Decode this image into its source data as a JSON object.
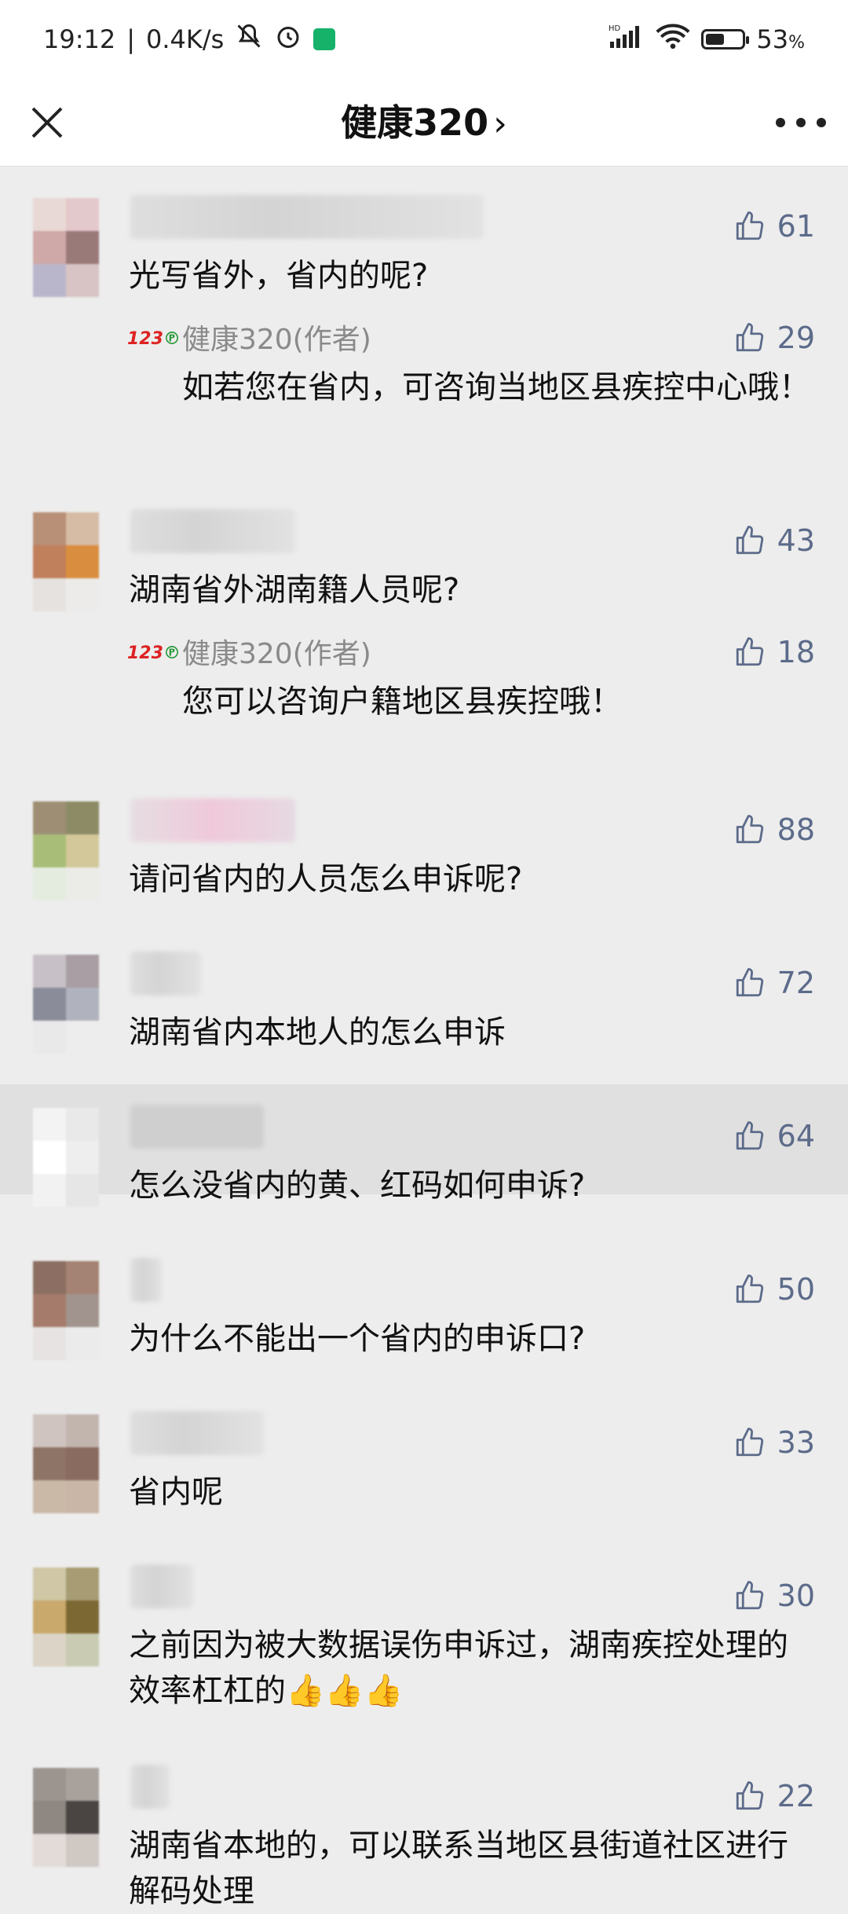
{
  "status_bar": {
    "time": "19:12",
    "speed": "0.4K/s",
    "battery": "53",
    "battery_unit": "%",
    "battery_level": 0.53,
    "icons": [
      "mute-icon",
      "alarm-icon",
      "phone-app-icon",
      "signal-hd-icon",
      "wifi-icon",
      "battery-icon"
    ]
  },
  "nav": {
    "title": "健康320",
    "chevron": "›",
    "close_icon": "close-icon",
    "more_icon": "more-icon"
  },
  "comments": [
    {
      "text": "光写省外，省内的呢?",
      "likes": "61",
      "reply": {
        "author": "健康320(作者)",
        "text": "如若您在省内，可咨询当地区县疾控中心哦！",
        "likes": "29"
      }
    },
    {
      "text": "湖南省外湖南籍人员呢?",
      "likes": "43",
      "reply": {
        "author": "健康320(作者)",
        "text": "您可以咨询户籍地区县疾控哦！",
        "likes": "18"
      }
    },
    {
      "text": "请问省内的人员怎么申诉呢?",
      "likes": "88"
    },
    {
      "text": "湖南省内本地人的怎么申诉",
      "likes": "72"
    },
    {
      "text": "怎么没省内的黄、红码如何申诉?",
      "likes": "64"
    },
    {
      "text": "为什么不能出一个省内的申诉口?",
      "likes": "50"
    },
    {
      "text": "省内呢",
      "likes": "33"
    },
    {
      "text": "之前因为被大数据误伤申诉过，湖南疾控处理的效率杠杠的",
      "likes": "30",
      "emoji": "👍👍👍"
    },
    {
      "text": "湖南省本地的，可以联系当地区县街道社区进行解码处理",
      "likes": "22"
    }
  ],
  "colors": {
    "like": "#5c6b8a",
    "background": "#ededed",
    "highlight_row": "#e0e0e0"
  }
}
